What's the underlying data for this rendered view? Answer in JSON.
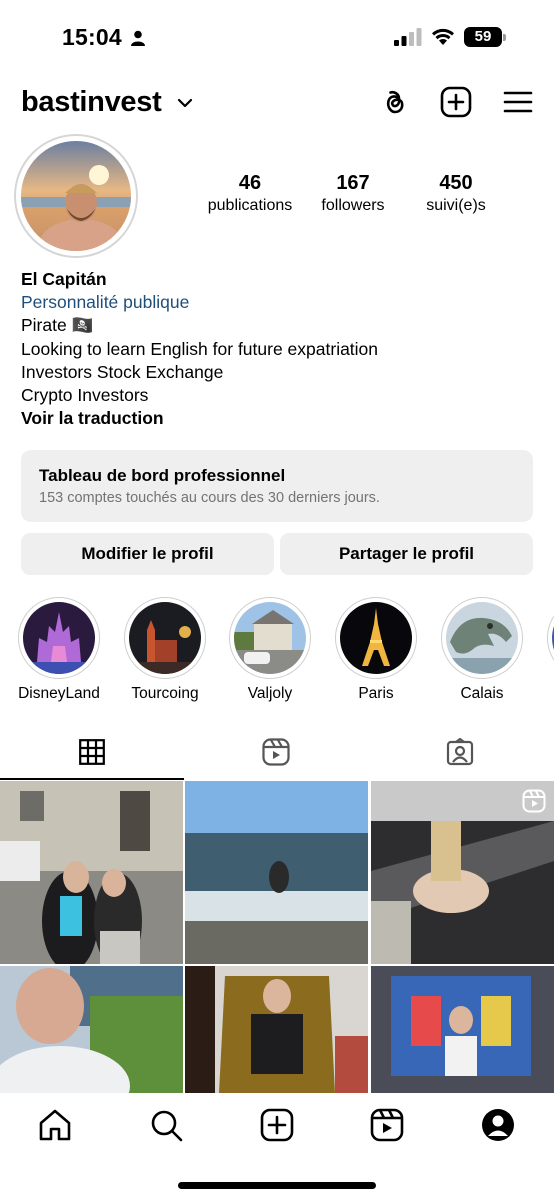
{
  "status_bar": {
    "time": "15:04",
    "battery": "59"
  },
  "header": {
    "username": "bastinvest"
  },
  "profile": {
    "stats": [
      {
        "value": "46",
        "label": "publications"
      },
      {
        "value": "167",
        "label": "followers"
      },
      {
        "value": "450",
        "label": "suivi(e)s"
      }
    ],
    "name": "El Capitán",
    "category": "Personnalité publique",
    "bio_lines": [
      "Pirate 🏴‍☠️",
      "Looking to learn English for future expatriation",
      "Investors Stock Exchange",
      "Crypto Investors"
    ],
    "translate_link": "Voir la traduction"
  },
  "dashboard": {
    "title": "Tableau de bord professionnel",
    "subtitle": "153 comptes touchés au cours des 30 derniers jours."
  },
  "actions": {
    "edit_label": "Modifier le profil",
    "share_label": "Partager le profil"
  },
  "highlights": [
    {
      "label": "DisneyLand"
    },
    {
      "label": "Tourcoing"
    },
    {
      "label": "Valjoly"
    },
    {
      "label": "Paris"
    },
    {
      "label": "Calais"
    }
  ],
  "tabs": [
    {
      "icon": "grid-icon",
      "active": true
    },
    {
      "icon": "reels-icon",
      "active": false
    },
    {
      "icon": "tagged-icon",
      "active": false
    }
  ],
  "bottom_nav": [
    {
      "icon": "home-icon"
    },
    {
      "icon": "search-icon"
    },
    {
      "icon": "create-icon"
    },
    {
      "icon": "reels-icon"
    },
    {
      "icon": "profile-icon"
    }
  ],
  "colors": {
    "category_link": "#1f4e79",
    "button_bg": "#efefef",
    "secondary_text": "#737373"
  }
}
